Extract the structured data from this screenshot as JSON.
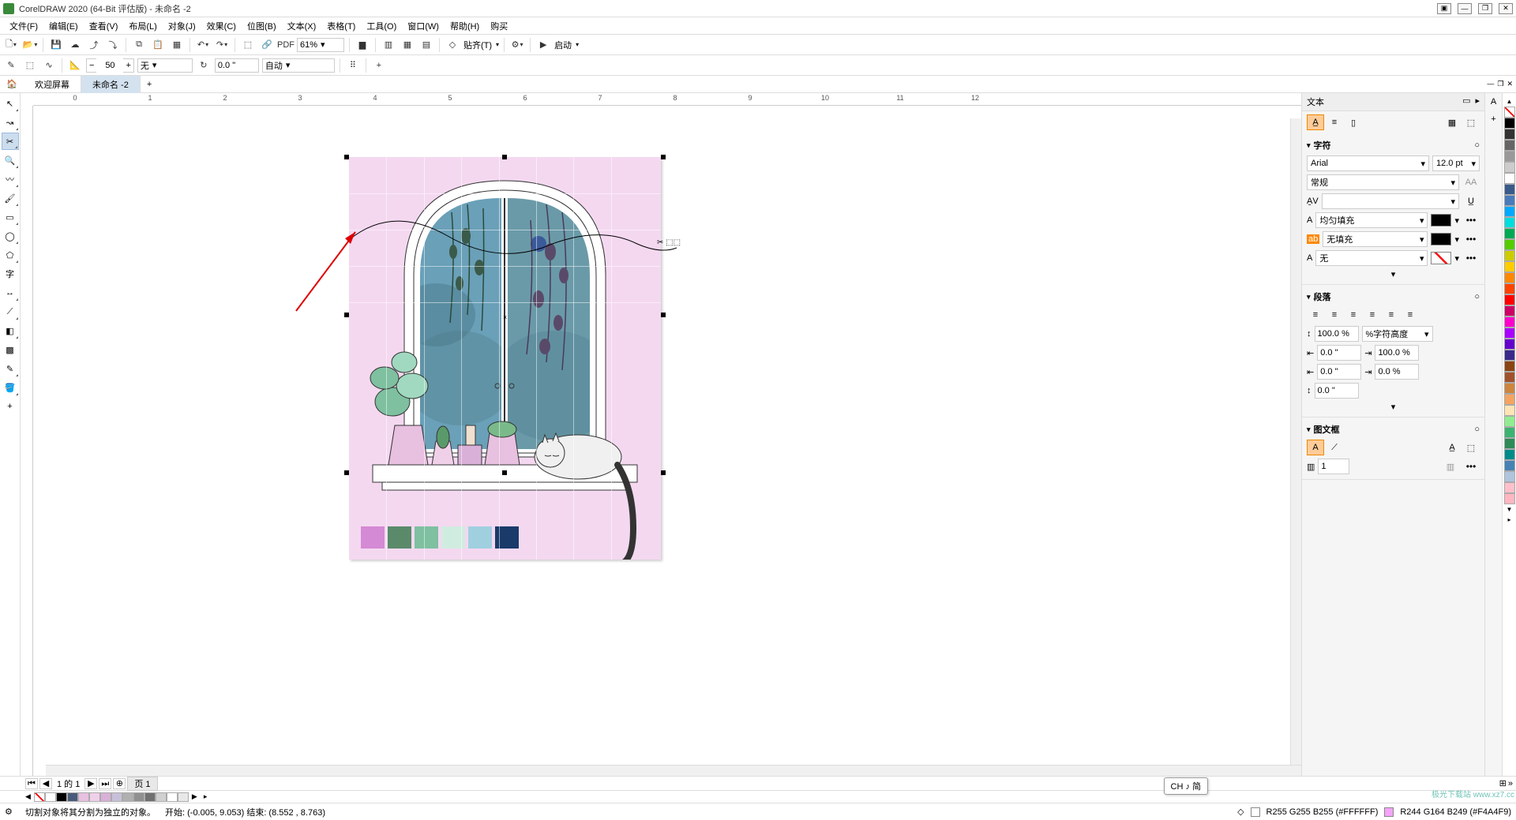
{
  "app": {
    "title": "CorelDRAW 2020 (64-Bit 评估版) - 未命名 -2"
  },
  "menu": [
    "文件(F)",
    "编辑(E)",
    "查看(V)",
    "布局(L)",
    "对象(J)",
    "效果(C)",
    "位图(B)",
    "文本(X)",
    "表格(T)",
    "工具(O)",
    "窗口(W)",
    "帮助(H)",
    "购买"
  ],
  "toolbar1": {
    "zoom": "61%",
    "snap_label": "贴齐(T)",
    "launch_label": "启动"
  },
  "toolbar2": {
    "nodes_value": "50",
    "preset_value": "无",
    "rotation_value": "0.0 \"",
    "auto_value": "自动"
  },
  "tabs": {
    "home": "🏠",
    "items": [
      "欢迎屏幕",
      "未命名 -2"
    ],
    "active": 1
  },
  "ruler_h": [
    "0",
    "1",
    "2",
    "3",
    "4",
    "5",
    "6",
    "7",
    "8",
    "9",
    "10",
    "11",
    "12"
  ],
  "docker": {
    "title": "文本",
    "char_section": "字符",
    "font_family": "Arial",
    "font_size": "12.0 pt",
    "font_style": "常规",
    "kerning_label": "",
    "fill_label": "均匀填充",
    "bgfill_label": "无填充",
    "outline_label": "无",
    "para_section": "段落",
    "line_spacing": "100.0 %",
    "char_height_label": "%字符高度",
    "left_indent": "0.0 \"",
    "first_line": "100.0 %",
    "right_indent": "0.0 \"",
    "hang_indent": "0.0 %",
    "space_before": "0.0 \"",
    "frame_section": "图文框",
    "columns_value": "1"
  },
  "page_nav": {
    "position": "1 的 1",
    "label": "页 1"
  },
  "status": {
    "hint": "切割对象将其分割为独立的对象。",
    "coords": "开始:   (-0.005, 9.053)  结束:   (8.552 , 8.763)",
    "fill_info": "R255 G255 B255 (#FFFFFF)",
    "fill_info2": "R244 G164 B249 (#F4A4F9)"
  },
  "ime": "CH ♪ 简",
  "watermark": "极光下载站 www.xz7.cc",
  "chart_colors": [
    "#d48ad4",
    "#5a8a6a",
    "#7ec0a0",
    "#d0ece0",
    "#a0d0e0",
    "#1a3a6a"
  ],
  "bottom_colors": [
    "#ffffff",
    "#000000",
    "#2a3a5a",
    "#5a7a9a",
    "#9ab0c0",
    "#e8d8c8",
    "#f0c0d0",
    "#d0c0e0",
    "#c0d0e8",
    "#a0a0a0",
    "#c0c0c0",
    "#ffffff",
    "#e0e0e0",
    "#ffffff"
  ],
  "right_colors": [
    "#ffffff",
    "#000000",
    "#333333",
    "#666666",
    "#999999",
    "#cccccc",
    "#ff0000",
    "#ff8800",
    "#ffff00",
    "#88ff00",
    "#00ff00",
    "#00ff88",
    "#00ffff",
    "#0088ff",
    "#0000ff",
    "#8800ff",
    "#ff00ff",
    "#ff0088",
    "#8b4513",
    "#800000",
    "#808000",
    "#008000",
    "#008080",
    "#000080",
    "#800080",
    "#ffc0cb",
    "#ffd700",
    "#f0e68c",
    "#90ee90"
  ]
}
